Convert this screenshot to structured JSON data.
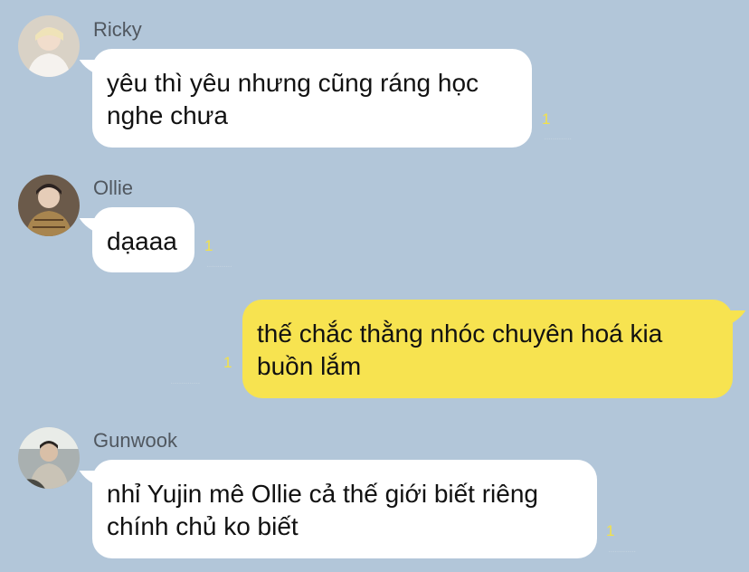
{
  "colors": {
    "background": "#b2c6d9",
    "incoming_bubble": "#ffffff",
    "outgoing_bubble": "#f7e350",
    "unread_count": "#f2e14a",
    "sender_name": "#50575f"
  },
  "messages": [
    {
      "direction": "incoming",
      "sender": "Ricky",
      "avatar": "profile-photo",
      "text": "yêu thì yêu nhưng cũng ráng học\nnghe chưa",
      "unread": "1"
    },
    {
      "direction": "incoming",
      "sender": "Ollie",
      "avatar": "profile-photo",
      "text": "dạaaa",
      "unread": "1"
    },
    {
      "direction": "outgoing",
      "text": "thế chắc thằng nhóc chuyên hoá kia\nbuồn lắm",
      "unread": "1"
    },
    {
      "direction": "incoming",
      "sender": "Gunwook",
      "avatar": "profile-photo",
      "text": "nhỉ Yujin mê Ollie cả thế giới biết riêng\nchính chủ ko biết",
      "unread": "1"
    }
  ]
}
